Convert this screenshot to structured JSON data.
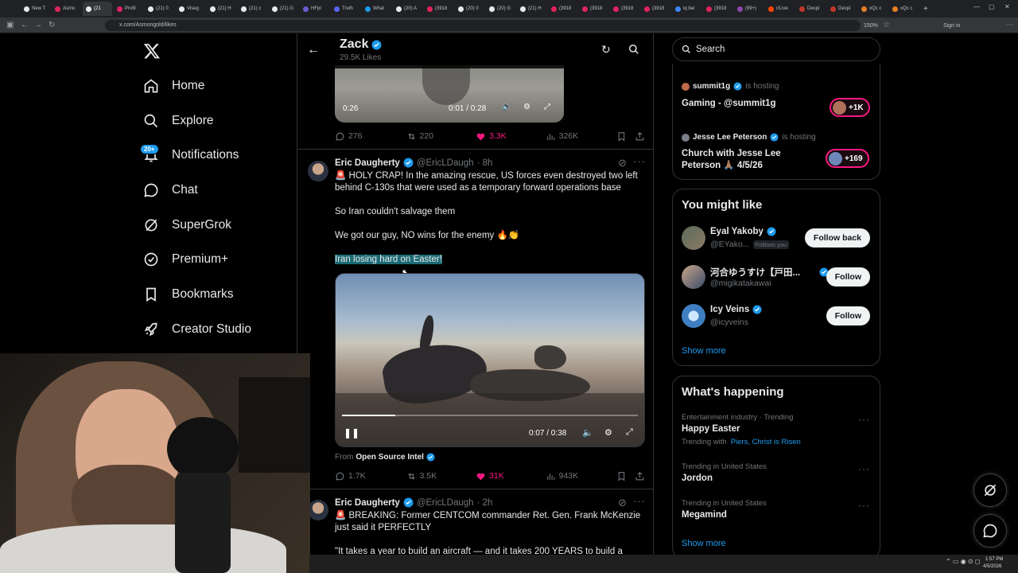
{
  "browser": {
    "tabs": [
      "New T",
      "Asmo",
      "(21",
      "Profil",
      "(21) 0",
      "Viseg",
      "(21) H",
      "(21) c",
      "(21) G",
      "HFpl",
      "Truth",
      "What",
      "(20) A",
      "(3918",
      "(20) 0",
      "(20) G",
      "(21) H",
      "(3918",
      "(3918",
      "(3918",
      "(3918",
      "iq bei",
      "(3918",
      "(99+)",
      "r/Live",
      "Despi",
      "Despi",
      "xQc c",
      "xQc c"
    ],
    "url": "x.com/Asmongold/likes",
    "zoom": "150%",
    "sign_in": "Sign in"
  },
  "nav": {
    "items": [
      {
        "label": "Home",
        "icon": "home-icon"
      },
      {
        "label": "Explore",
        "icon": "search-icon"
      },
      {
        "label": "Notifications",
        "icon": "bell-icon"
      },
      {
        "label": "Chat",
        "icon": "chat-icon"
      },
      {
        "label": "SuperGrok",
        "icon": "grok-icon"
      },
      {
        "label": "Premium+",
        "icon": "premium-icon"
      },
      {
        "label": "Bookmarks",
        "icon": "bookmark-icon"
      },
      {
        "label": "Creator Studio",
        "icon": "rocket-icon"
      }
    ],
    "notifications_badge": "20+"
  },
  "header": {
    "name": "Zack",
    "subtitle": "29.5K Likes"
  },
  "prev_post": {
    "video_time_left": "0:26",
    "video_time": "0:01 / 0:28",
    "stats": {
      "replies": "276",
      "reposts": "220",
      "likes": "3.3K",
      "views": "326K"
    }
  },
  "post1": {
    "author": "Eric Daugherty",
    "handle": "@EricLDaugh",
    "time": "· 8h",
    "text1": "🚨 HOLY CRAP! In the amazing rescue, US forces even destroyed two left behind C-130s that were used as a temporary forward operations base",
    "text2": "So Iran couldn't salvage them",
    "text3": "We got our guy, NO wins for the enemy 🔥👏",
    "text4": "Iran losing hard on Easter!",
    "video_time": "0:07 / 0:38",
    "from_prefix": "From",
    "from_source": "Open Source Intel",
    "stats": {
      "replies": "1.7K",
      "reposts": "3.5K",
      "likes": "31K",
      "views": "943K"
    }
  },
  "post2": {
    "author": "Eric Daugherty",
    "handle": "@EricLDaugh",
    "time": "· 2h",
    "text1": "🚨 BREAKING: Former CENTCOM commander Ret. Gen. Frank McKenzie just said it PERFECTLY",
    "text2": "\"It takes a year to build an aircraft — and it takes 200 YEARS to build a"
  },
  "search": {
    "placeholder": "Search"
  },
  "spaces": [
    {
      "host": "summit1g",
      "hosting": "is hosting",
      "title": "Gaming - @summit1g",
      "count": "+1K"
    },
    {
      "host": "Jesse Lee Peterson",
      "hosting": "is hosting",
      "title": "Church with Jesse Lee Peterson 🙏🏽 4/5/26",
      "count": "+169"
    }
  ],
  "who_to_follow": {
    "title": "You might like",
    "users": [
      {
        "name": "Eyal Yakoby",
        "handle": "@EYako...",
        "follows_you": "Follows you",
        "button": "Follow back"
      },
      {
        "name": "河合ゆうすけ【戸田...",
        "handle": "@migikatakawai",
        "follows_you": "",
        "button": "Follow"
      },
      {
        "name": "Icy Veins",
        "handle": "@icyveins",
        "follows_you": "",
        "button": "Follow"
      }
    ],
    "show_more": "Show more"
  },
  "trends": {
    "title": "What's happening",
    "items": [
      {
        "meta": "Entertainment industry · Trending",
        "name": "Happy Easter",
        "with_label": "Trending with",
        "with": "Piers, Christ is Risen"
      },
      {
        "meta": "Trending in United States",
        "name": "Jordon"
      },
      {
        "meta": "Trending in United States",
        "name": "Megamind"
      }
    ],
    "show_more": "Show more"
  },
  "taskbar": {
    "time": "1:57 PM",
    "date": "4/5/2026"
  },
  "colors": {
    "accent": "#1d9bf0",
    "like": "#f91880",
    "bg": "#000000",
    "border": "#2f3336",
    "muted": "#71767b"
  }
}
